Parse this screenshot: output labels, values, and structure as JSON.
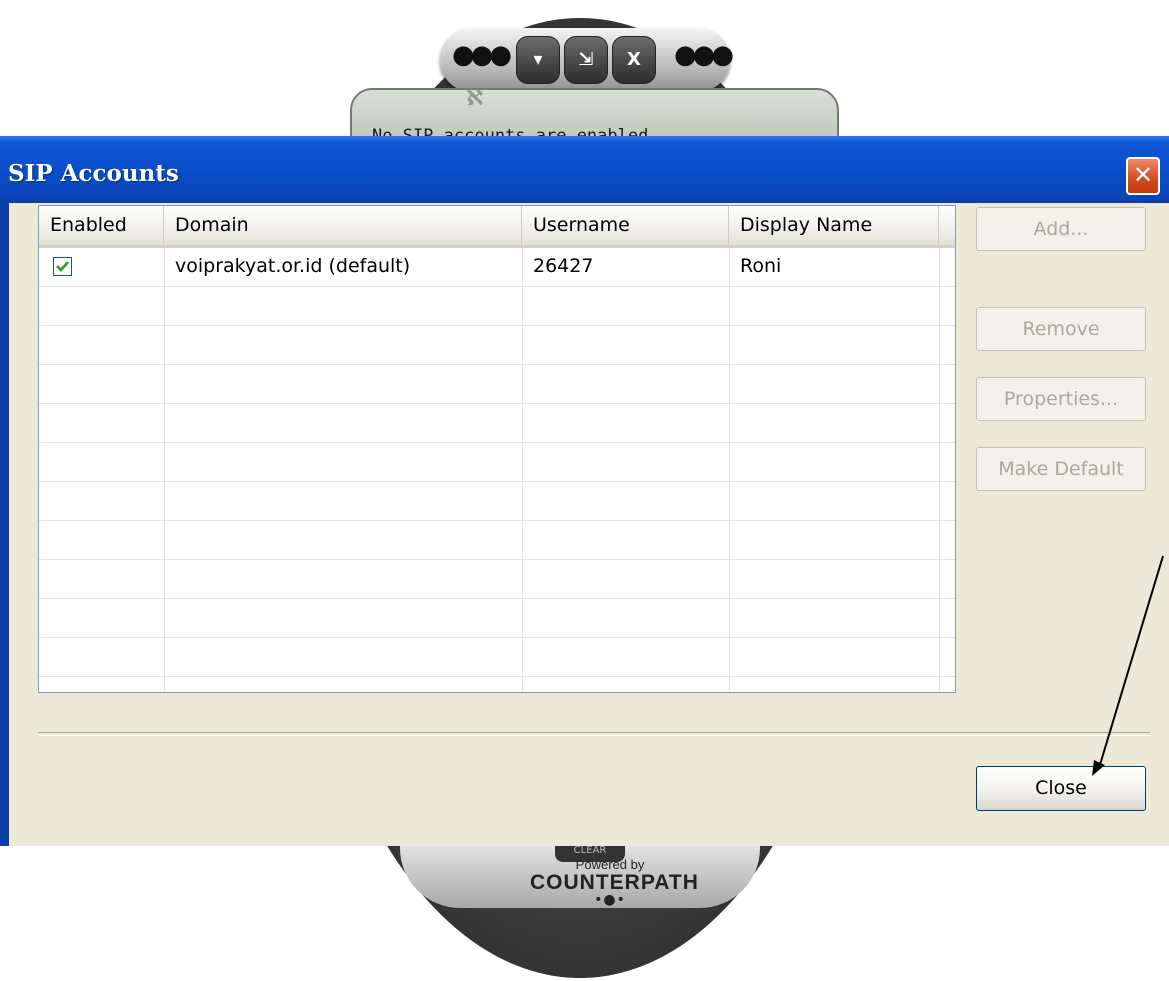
{
  "phone": {
    "top_buttons": [
      "▾",
      "⇲",
      "X"
    ],
    "status_text": "No SIP accounts are enabled",
    "logo_glyph": "ℵ",
    "clear_label": "CLEAR",
    "powered_by": "Powered by",
    "brand": "COUNTERPATH"
  },
  "dialog": {
    "title": "SIP Accounts",
    "close_glyph": "✕",
    "columns": {
      "enabled": "Enabled",
      "domain": "Domain",
      "username": "Username",
      "display_name": "Display Name"
    },
    "rows": [
      {
        "enabled": true,
        "domain": "voiprakyat.or.id (default)",
        "username": "26427",
        "display_name": "Roni"
      }
    ],
    "buttons": {
      "add": "Add...",
      "remove": "Remove",
      "properties": "Properties...",
      "make_default": "Make Default",
      "close": "Close"
    }
  },
  "colors": {
    "titlebar": "#0a4dc8",
    "dialog_bg": "#ece9d8",
    "close_button": "#d64a1f",
    "check": "#21a121",
    "annotation_arrow": "#000000"
  }
}
